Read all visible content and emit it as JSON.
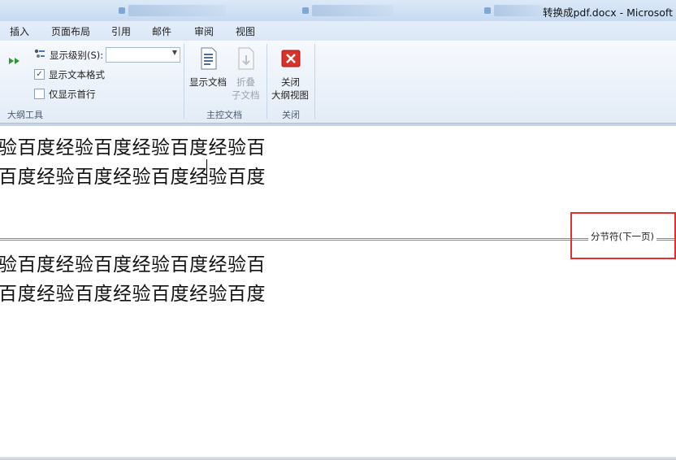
{
  "window": {
    "document_title": "转换成pdf.docx - Microsoft"
  },
  "ribbon": {
    "tabs": [
      "插入",
      "页面布局",
      "引用",
      "邮件",
      "审阅",
      "视图"
    ],
    "outline_tools": {
      "show_level_label": "显示级别(S):",
      "show_level_value": "",
      "show_text_format_label": "显示文本格式",
      "show_text_format_checked": true,
      "first_line_only_label": "仅显示首行",
      "first_line_only_checked": false,
      "group_label": "大纲工具"
    },
    "master_document": {
      "show_document_label": "显示文档",
      "collapse_subdocs_line1": "折叠",
      "collapse_subdocs_line2": "子文档",
      "group_label": "主控文档"
    },
    "close": {
      "close_outline_line1": "关闭",
      "close_outline_line2": "大纲视图",
      "group_label": "关闭"
    }
  },
  "document": {
    "paragraphs": [
      "验百度经验百度经验百度经验百",
      "百度经验百度经验百度经验百度",
      "验百度经验百度经验百度经验百",
      "百度经验百度经验百度经验百度"
    ],
    "section_break_label": "分节符(下一页)"
  },
  "colors": {
    "highlight_box": "#e03030",
    "ribbon_bg": "#e3ecf7"
  }
}
